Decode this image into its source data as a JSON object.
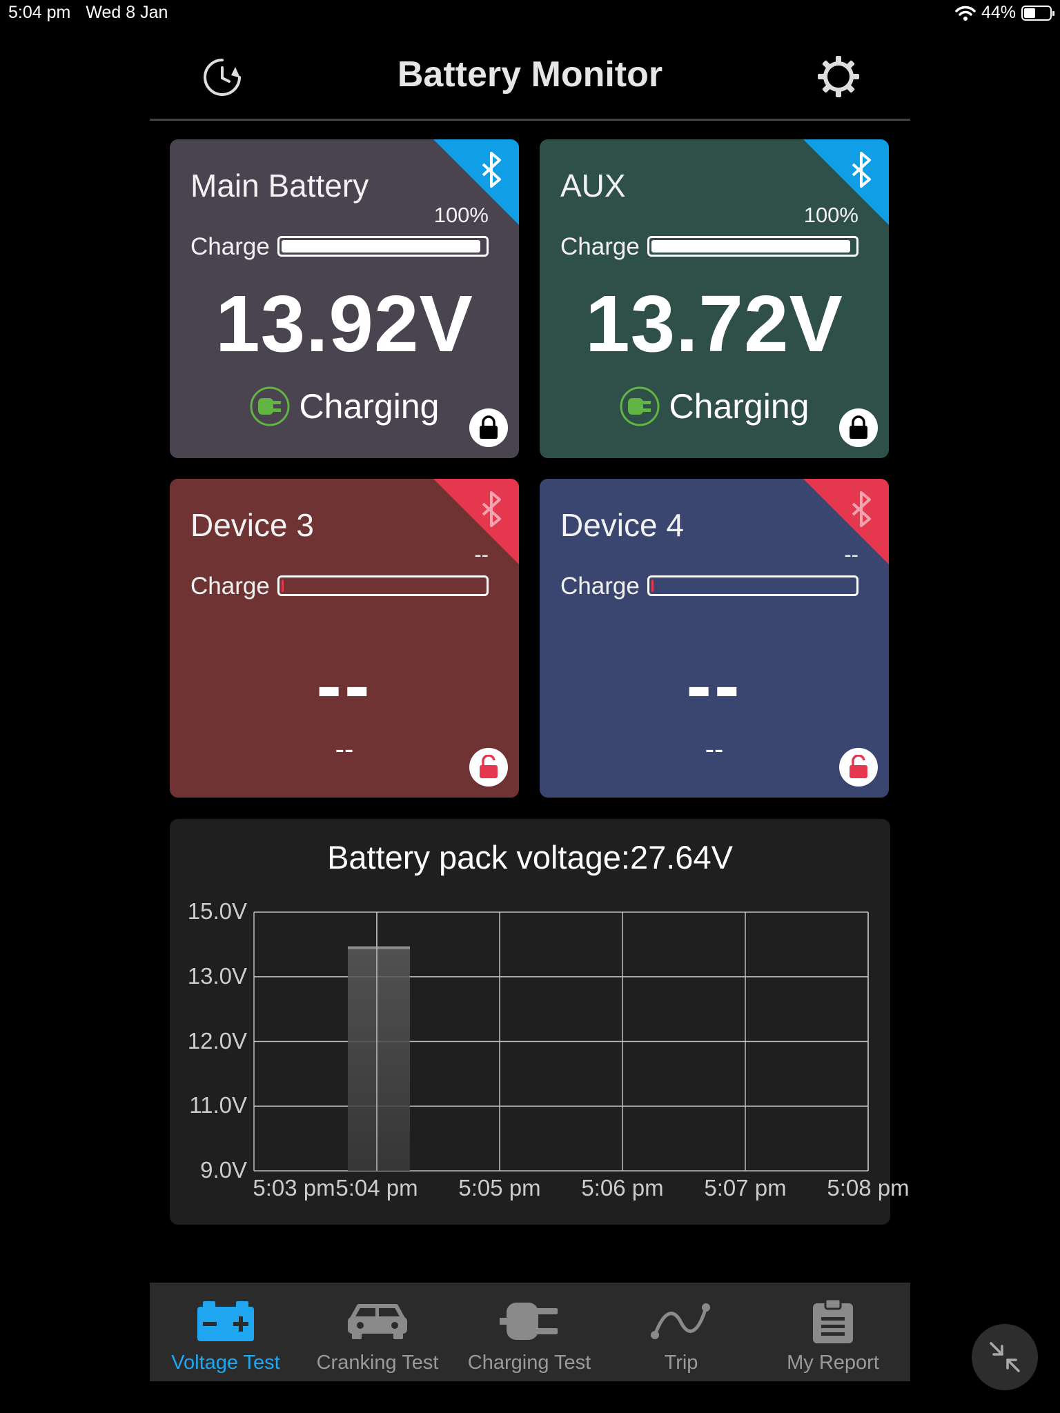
{
  "status_bar": {
    "time": "5:04 pm",
    "date": "Wed 8 Jan",
    "battery_percent": "44%",
    "battery_level": 0.44
  },
  "header": {
    "title": "Battery Monitor",
    "history_icon": "history-icon",
    "settings_icon": "gear-icon"
  },
  "cards": [
    {
      "title": "Main Battery",
      "percent": "100%",
      "charge_label": "Charge",
      "charge_level": 1.0,
      "voltage": "13.92V",
      "status": "Charging",
      "connected": true,
      "locked": true,
      "bg": "#4a4350"
    },
    {
      "title": "AUX",
      "percent": "100%",
      "charge_label": "Charge",
      "charge_level": 1.0,
      "voltage": "13.72V",
      "status": "Charging",
      "connected": true,
      "locked": true,
      "bg": "#2f5048"
    },
    {
      "title": "Device 3",
      "percent": "--",
      "charge_label": "Charge",
      "charge_level": 0.0,
      "voltage": "--",
      "status": "--",
      "connected": false,
      "locked": false,
      "bg": "#6f3333"
    },
    {
      "title": "Device 4",
      "percent": "--",
      "charge_label": "Charge",
      "charge_level": 0.0,
      "voltage": "--",
      "status": "--",
      "connected": false,
      "locked": false,
      "bg": "#3a4670"
    }
  ],
  "colors": {
    "bt_connected": "#109ee6",
    "bt_disconnected": "#e5384e",
    "charging_green": "#62b443",
    "accent": "#1ea7f0"
  },
  "chart_data": {
    "type": "bar",
    "title": "Battery pack voltage:27.64V",
    "y_tick_labels": [
      "15.0V",
      "13.0V",
      "12.0V",
      "11.0V",
      "9.0V"
    ],
    "x_tick_labels": [
      "5:03 pm",
      "5:04 pm",
      "5:05 pm",
      "5:06 pm",
      "5:07 pm",
      "5:08 pm"
    ],
    "categories": [
      "5:03 pm",
      "5:04 pm",
      "5:05 pm",
      "5:06 pm",
      "5:07 pm",
      "5:08 pm"
    ],
    "values": [
      null,
      13.9,
      null,
      null,
      null,
      null
    ],
    "ylim": [
      9.0,
      15.0
    ],
    "grid": true,
    "xlabel": "",
    "ylabel": ""
  },
  "tabs": [
    {
      "label": "Voltage Test",
      "icon": "car-battery-icon",
      "active": true
    },
    {
      "label": "Cranking Test",
      "icon": "car-icon",
      "active": false
    },
    {
      "label": "Charging Test",
      "icon": "plug-icon",
      "active": false
    },
    {
      "label": "Trip",
      "icon": "route-icon",
      "active": false
    },
    {
      "label": "My Report",
      "icon": "clipboard-icon",
      "active": false
    }
  ],
  "float_button": {
    "icon": "collapse-arrows-icon"
  }
}
